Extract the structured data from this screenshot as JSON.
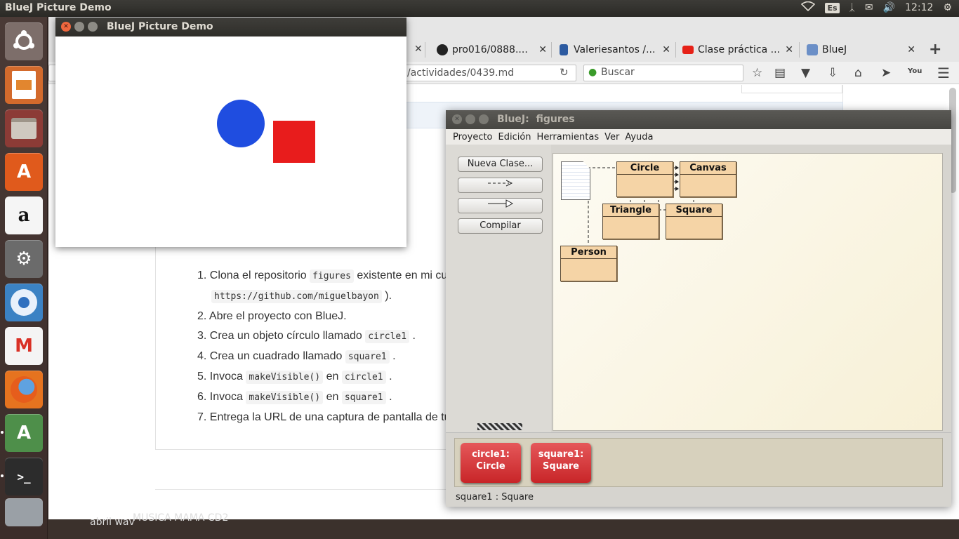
{
  "topbar": {
    "title": "BlueJ Picture Demo",
    "keyboard_layout": "Es",
    "clock": "12:12"
  },
  "launcher": {
    "items": [
      "ubuntu-home-icon",
      "impress-icon",
      "files-icon",
      "software-center-icon",
      "amazon-icon",
      "system-settings-icon",
      "chromium-icon",
      "gmail-icon",
      "firefox-icon",
      "update-manager-icon",
      "terminal-icon",
      "removable-drive-icon"
    ]
  },
  "browser": {
    "tabs": [
      {
        "label": "pro016/0888....",
        "icon": "github-icon"
      },
      {
        "label": "Valeriesantos /...",
        "icon": "database-icon"
      },
      {
        "label": "Clase práctica ...",
        "icon": "youtube-icon"
      },
      {
        "label": "BlueJ",
        "icon": "bluej-icon"
      }
    ],
    "url": "/actividades/0439.md",
    "search_placeholder": "Buscar",
    "steps": [
      {
        "num": "1.",
        "text": "Clona el repositorio",
        "code": "figures",
        "rest": "existente en mi cu",
        "line2_code": "https://github.com/miguelbayon",
        "line2_rest": ")."
      },
      {
        "num": "2.",
        "text": "Abre el proyecto con BlueJ."
      },
      {
        "num": "3.",
        "text": "Crea un objeto círculo llamado",
        "code": "circle1",
        "rest": "."
      },
      {
        "num": "4.",
        "text": "Crea un cuadrado llamado",
        "code": "square1",
        "rest": "."
      },
      {
        "num": "5.",
        "text": "Invoca",
        "code": "makeVisible()",
        "mid": "en",
        "code2": "circle1",
        "rest": "."
      },
      {
        "num": "6.",
        "text": "Invoca",
        "code": "makeVisible()",
        "mid": "en",
        "code2": "square1",
        "rest": "."
      },
      {
        "num": "7.",
        "text": "Entrega la URL de una captura de pantalla de tu"
      }
    ],
    "desktop_text": "abril wav",
    "desktop_text2": "MUSICA MAMA CD2"
  },
  "picture_window": {
    "title": "BlueJ Picture Demo",
    "colors": {
      "circle": "#1f4de0",
      "square": "#e81c1c"
    }
  },
  "bluej": {
    "title": "BlueJ:  figures",
    "menu": [
      "Proyecto",
      "Edición",
      "Herramientas",
      "Ver",
      "Ayuda"
    ],
    "buttons": {
      "new_class": "Nueva Clase...",
      "compile": "Compilar"
    },
    "classes": [
      "Circle",
      "Canvas",
      "Triangle",
      "Square",
      "Person"
    ],
    "objects": [
      {
        "name": "circle1:",
        "type": "Circle"
      },
      {
        "name": "square1:",
        "type": "Square"
      }
    ],
    "status": "square1 : Square"
  }
}
